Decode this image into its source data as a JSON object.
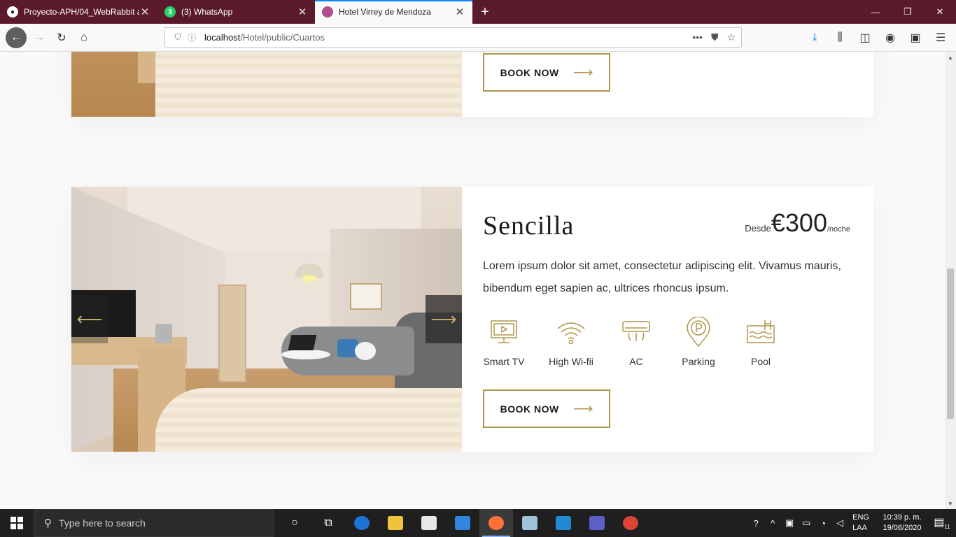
{
  "browser": {
    "tabs": [
      {
        "title": "Proyecto-APH/04_WebRabbit a",
        "favicon": "github-icon",
        "active": false
      },
      {
        "title": "(3) WhatsApp",
        "favicon": "whatsapp-icon",
        "active": false
      },
      {
        "title": "Hotel Virrey de Mendoza",
        "favicon": "hotel-icon",
        "active": true
      }
    ],
    "new_tab_label": "+",
    "url_host": "localhost",
    "url_path": "/Hotel/public/Cuartos",
    "tab_bar_color": "#5b1a2c",
    "accent_color": "#0a84ff"
  },
  "page": {
    "accent_color": "#b0964a",
    "rooms": [
      {
        "book_label": "BOOK NOW"
      },
      {
        "name": "Sencilla",
        "price_from": "Desde",
        "price_amount": "€300",
        "price_unit": "/noche",
        "description": "Lorem ipsum dolor sit amet, consectetur adipiscing elit. Vivamus mauris, bibendum eget sapien ac, ultrices rhoncus ipsum.",
        "amenities": [
          {
            "label": "Smart TV",
            "icon": "smart-tv-icon"
          },
          {
            "label": "High Wi-fii",
            "icon": "wifi-icon"
          },
          {
            "label": "AC",
            "icon": "air-conditioner-icon"
          },
          {
            "label": "Parking",
            "icon": "parking-icon"
          },
          {
            "label": "Pool",
            "icon": "pool-icon"
          }
        ],
        "book_label": "BOOK NOW"
      }
    ]
  },
  "taskbar": {
    "search_placeholder": "Type here to search",
    "language_line1": "ENG",
    "language_line2": "LAA",
    "time": "10:39 p. m.",
    "date": "19/06/2020",
    "notification_count": "11"
  }
}
